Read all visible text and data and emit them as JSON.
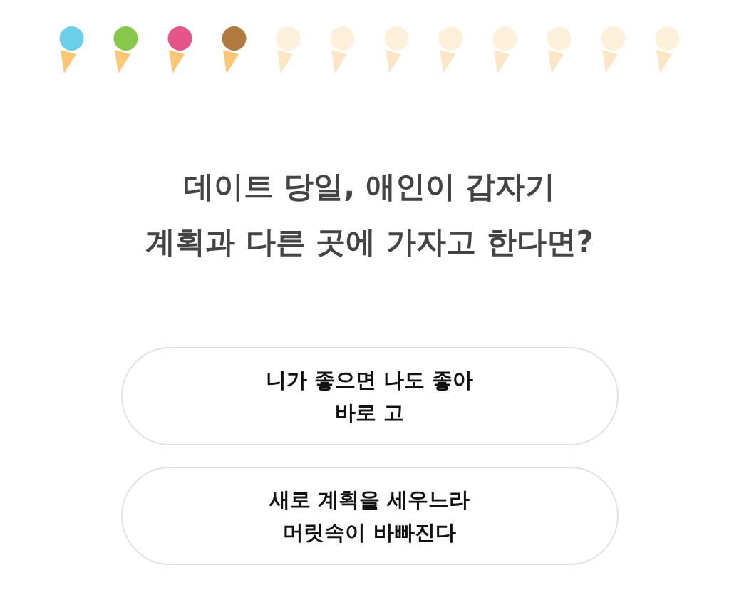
{
  "progress": [
    {
      "done": true,
      "color": "#6ccfea"
    },
    {
      "done": true,
      "color": "#86c94a"
    },
    {
      "done": true,
      "color": "#e4558a"
    },
    {
      "done": true,
      "color": "#b07a3e"
    },
    {
      "done": false
    },
    {
      "done": false
    },
    {
      "done": false
    },
    {
      "done": false
    },
    {
      "done": false
    },
    {
      "done": false
    },
    {
      "done": false
    },
    {
      "done": false
    }
  ],
  "question": "데이트 당일, 애인이 갑자기\n계획과 다른 곳에 가자고 한다면?",
  "answers": [
    {
      "label": "니가 좋으면 나도 좋아\n바로 고"
    },
    {
      "label": "새로 계획을 세우느라\n머릿속이 바빠진다"
    }
  ]
}
